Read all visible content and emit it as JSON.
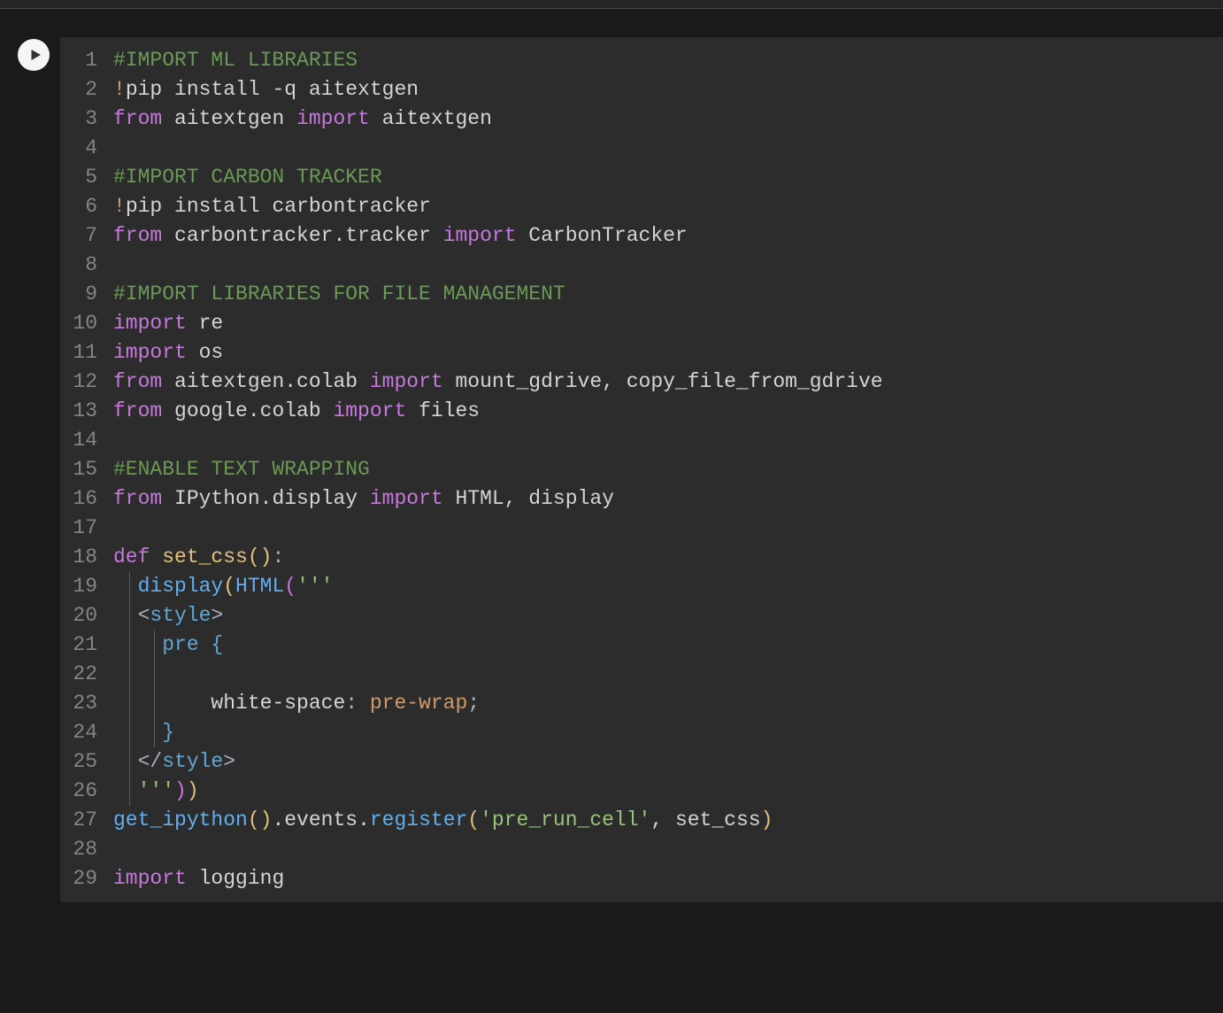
{
  "cell": {
    "lines": [
      {
        "n": 1,
        "indent": 0,
        "tokens": [
          {
            "t": "#IMPORT ML LIBRARIES",
            "c": "tok-comment"
          }
        ]
      },
      {
        "n": 2,
        "indent": 0,
        "tokens": [
          {
            "t": "!",
            "c": "tok-bang"
          },
          {
            "t": "pip install -q aitextgen",
            "c": "tok-default"
          }
        ]
      },
      {
        "n": 3,
        "indent": 0,
        "tokens": [
          {
            "t": "from",
            "c": "tok-keyword"
          },
          {
            "t": " aitextgen ",
            "c": "tok-default"
          },
          {
            "t": "import",
            "c": "tok-keyword"
          },
          {
            "t": " aitextgen",
            "c": "tok-default"
          }
        ]
      },
      {
        "n": 4,
        "indent": 0,
        "tokens": []
      },
      {
        "n": 5,
        "indent": 0,
        "tokens": [
          {
            "t": "#IMPORT CARBON TRACKER",
            "c": "tok-comment"
          }
        ]
      },
      {
        "n": 6,
        "indent": 0,
        "tokens": [
          {
            "t": "!",
            "c": "tok-bang"
          },
          {
            "t": "pip install carbontracker",
            "c": "tok-default"
          }
        ]
      },
      {
        "n": 7,
        "indent": 0,
        "tokens": [
          {
            "t": "from",
            "c": "tok-keyword"
          },
          {
            "t": " carbontracker.tracker ",
            "c": "tok-default"
          },
          {
            "t": "import",
            "c": "tok-keyword"
          },
          {
            "t": " CarbonTracker",
            "c": "tok-default"
          }
        ]
      },
      {
        "n": 8,
        "indent": 0,
        "tokens": []
      },
      {
        "n": 9,
        "indent": 0,
        "tokens": [
          {
            "t": "#IMPORT LIBRARIES FOR FILE MANAGEMENT",
            "c": "tok-comment"
          }
        ]
      },
      {
        "n": 10,
        "indent": 0,
        "tokens": [
          {
            "t": "import",
            "c": "tok-keyword"
          },
          {
            "t": " re",
            "c": "tok-default"
          }
        ]
      },
      {
        "n": 11,
        "indent": 0,
        "tokens": [
          {
            "t": "import",
            "c": "tok-keyword"
          },
          {
            "t": " os",
            "c": "tok-default"
          }
        ]
      },
      {
        "n": 12,
        "indent": 0,
        "tokens": [
          {
            "t": "from",
            "c": "tok-keyword"
          },
          {
            "t": " aitextgen.colab ",
            "c": "tok-default"
          },
          {
            "t": "import",
            "c": "tok-keyword"
          },
          {
            "t": " mount_gdrive, copy_file_from_gdrive",
            "c": "tok-default"
          }
        ]
      },
      {
        "n": 13,
        "indent": 0,
        "tokens": [
          {
            "t": "from",
            "c": "tok-keyword"
          },
          {
            "t": " google.colab ",
            "c": "tok-default"
          },
          {
            "t": "import",
            "c": "tok-keyword"
          },
          {
            "t": " files",
            "c": "tok-default"
          }
        ]
      },
      {
        "n": 14,
        "indent": 0,
        "tokens": []
      },
      {
        "n": 15,
        "indent": 0,
        "tokens": [
          {
            "t": "#ENABLE TEXT WRAPPING",
            "c": "tok-comment"
          }
        ]
      },
      {
        "n": 16,
        "indent": 0,
        "tokens": [
          {
            "t": "from",
            "c": "tok-keyword"
          },
          {
            "t": " IPython.display ",
            "c": "tok-default"
          },
          {
            "t": "import",
            "c": "tok-keyword"
          },
          {
            "t": " HTML, display",
            "c": "tok-default"
          }
        ]
      },
      {
        "n": 17,
        "indent": 0,
        "tokens": []
      },
      {
        "n": 18,
        "indent": 0,
        "tokens": [
          {
            "t": "def ",
            "c": "tok-def"
          },
          {
            "t": "set_css",
            "c": "tok-funcname"
          },
          {
            "t": "(",
            "c": "tok-bracket1"
          },
          {
            "t": ")",
            "c": "tok-bracket1"
          },
          {
            "t": ":",
            "c": "tok-punct"
          }
        ]
      },
      {
        "n": 19,
        "indent": 1,
        "guides": [
          0
        ],
        "tokens": [
          {
            "t": "  ",
            "c": ""
          },
          {
            "t": "display",
            "c": "tok-call"
          },
          {
            "t": "(",
            "c": "tok-bracket1"
          },
          {
            "t": "HTML",
            "c": "tok-call"
          },
          {
            "t": "(",
            "c": "tok-bracket2"
          },
          {
            "t": "'''",
            "c": "tok-string"
          }
        ]
      },
      {
        "n": 20,
        "indent": 1,
        "guides": [
          0
        ],
        "tokens": [
          {
            "t": "  ",
            "c": ""
          },
          {
            "t": "<",
            "c": "tok-tagbr"
          },
          {
            "t": "style",
            "c": "tok-tag"
          },
          {
            "t": ">",
            "c": "tok-tagbr"
          }
        ]
      },
      {
        "n": 21,
        "indent": 2,
        "guides": [
          0,
          1
        ],
        "tokens": [
          {
            "t": "    ",
            "c": ""
          },
          {
            "t": "pre ",
            "c": "tok-tag"
          },
          {
            "t": "{",
            "c": "tok-brace-css"
          }
        ]
      },
      {
        "n": 22,
        "indent": 2,
        "guides": [
          0,
          1
        ],
        "tokens": []
      },
      {
        "n": 23,
        "indent": 3,
        "guides": [
          0,
          1
        ],
        "tokens": [
          {
            "t": "        ",
            "c": ""
          },
          {
            "t": "white-space",
            "c": "tok-cssprop"
          },
          {
            "t": ": ",
            "c": "tok-punct"
          },
          {
            "t": "pre-wrap",
            "c": "tok-cssval"
          },
          {
            "t": ";",
            "c": "tok-punct"
          }
        ]
      },
      {
        "n": 24,
        "indent": 2,
        "guides": [
          0,
          1
        ],
        "tokens": [
          {
            "t": "    ",
            "c": ""
          },
          {
            "t": "}",
            "c": "tok-brace-css"
          }
        ]
      },
      {
        "n": 25,
        "indent": 1,
        "guides": [
          0
        ],
        "tokens": [
          {
            "t": "  ",
            "c": ""
          },
          {
            "t": "</",
            "c": "tok-tagbr"
          },
          {
            "t": "style",
            "c": "tok-tag"
          },
          {
            "t": ">",
            "c": "tok-tagbr"
          }
        ]
      },
      {
        "n": 26,
        "indent": 1,
        "guides": [
          0
        ],
        "tokens": [
          {
            "t": "  ",
            "c": ""
          },
          {
            "t": "'''",
            "c": "tok-string"
          },
          {
            "t": ")",
            "c": "tok-bracket2"
          },
          {
            "t": ")",
            "c": "tok-bracket1"
          }
        ]
      },
      {
        "n": 27,
        "indent": 0,
        "tokens": [
          {
            "t": "get_ipython",
            "c": "tok-call"
          },
          {
            "t": "(",
            "c": "tok-bracket1"
          },
          {
            "t": ")",
            "c": "tok-bracket1"
          },
          {
            "t": ".events.",
            "c": "tok-default"
          },
          {
            "t": "register",
            "c": "tok-call"
          },
          {
            "t": "(",
            "c": "tok-bracket1"
          },
          {
            "t": "'pre_run_cell'",
            "c": "tok-string"
          },
          {
            "t": ", set_css",
            "c": "tok-default"
          },
          {
            "t": ")",
            "c": "tok-bracket1"
          }
        ]
      },
      {
        "n": 28,
        "indent": 0,
        "tokens": []
      },
      {
        "n": 29,
        "indent": 0,
        "tokens": [
          {
            "t": "import",
            "c": "tok-keyword"
          },
          {
            "t": " logging",
            "c": "tok-default"
          }
        ]
      }
    ]
  }
}
